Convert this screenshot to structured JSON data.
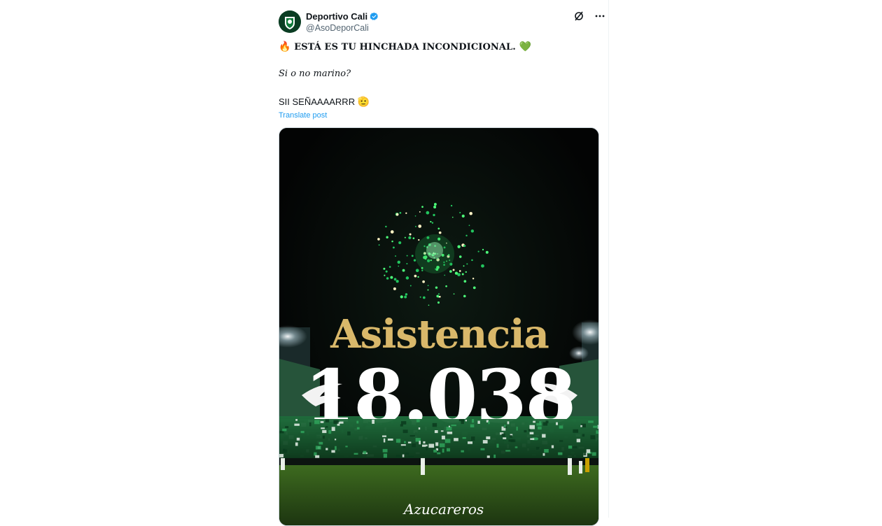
{
  "post": {
    "author": {
      "display_name": "Deportivo Cali",
      "handle": "@AsoDeporCali",
      "verified": true
    },
    "text": {
      "line1_emoji_start": "🔥",
      "line1": "ESTÁ ES TU HINCHADA INCONDICIONAL.",
      "line1_emoji_end": "💚",
      "line2": "Si o no marino?",
      "line3": "SII SEÑAAAARRR",
      "line3_emoji": "🫡"
    },
    "translate_label": "Translate post",
    "icons": {
      "grok": "grok-icon",
      "more": "more-icon",
      "verified": "verified-badge-icon"
    }
  },
  "media": {
    "headline": "Asistencia",
    "attendance": "18.038",
    "brand_script": "Azucareros",
    "colors": {
      "gold": "#d9b86a",
      "white": "#ffffff",
      "green": "#1ea64a",
      "sky": "#040505"
    }
  }
}
